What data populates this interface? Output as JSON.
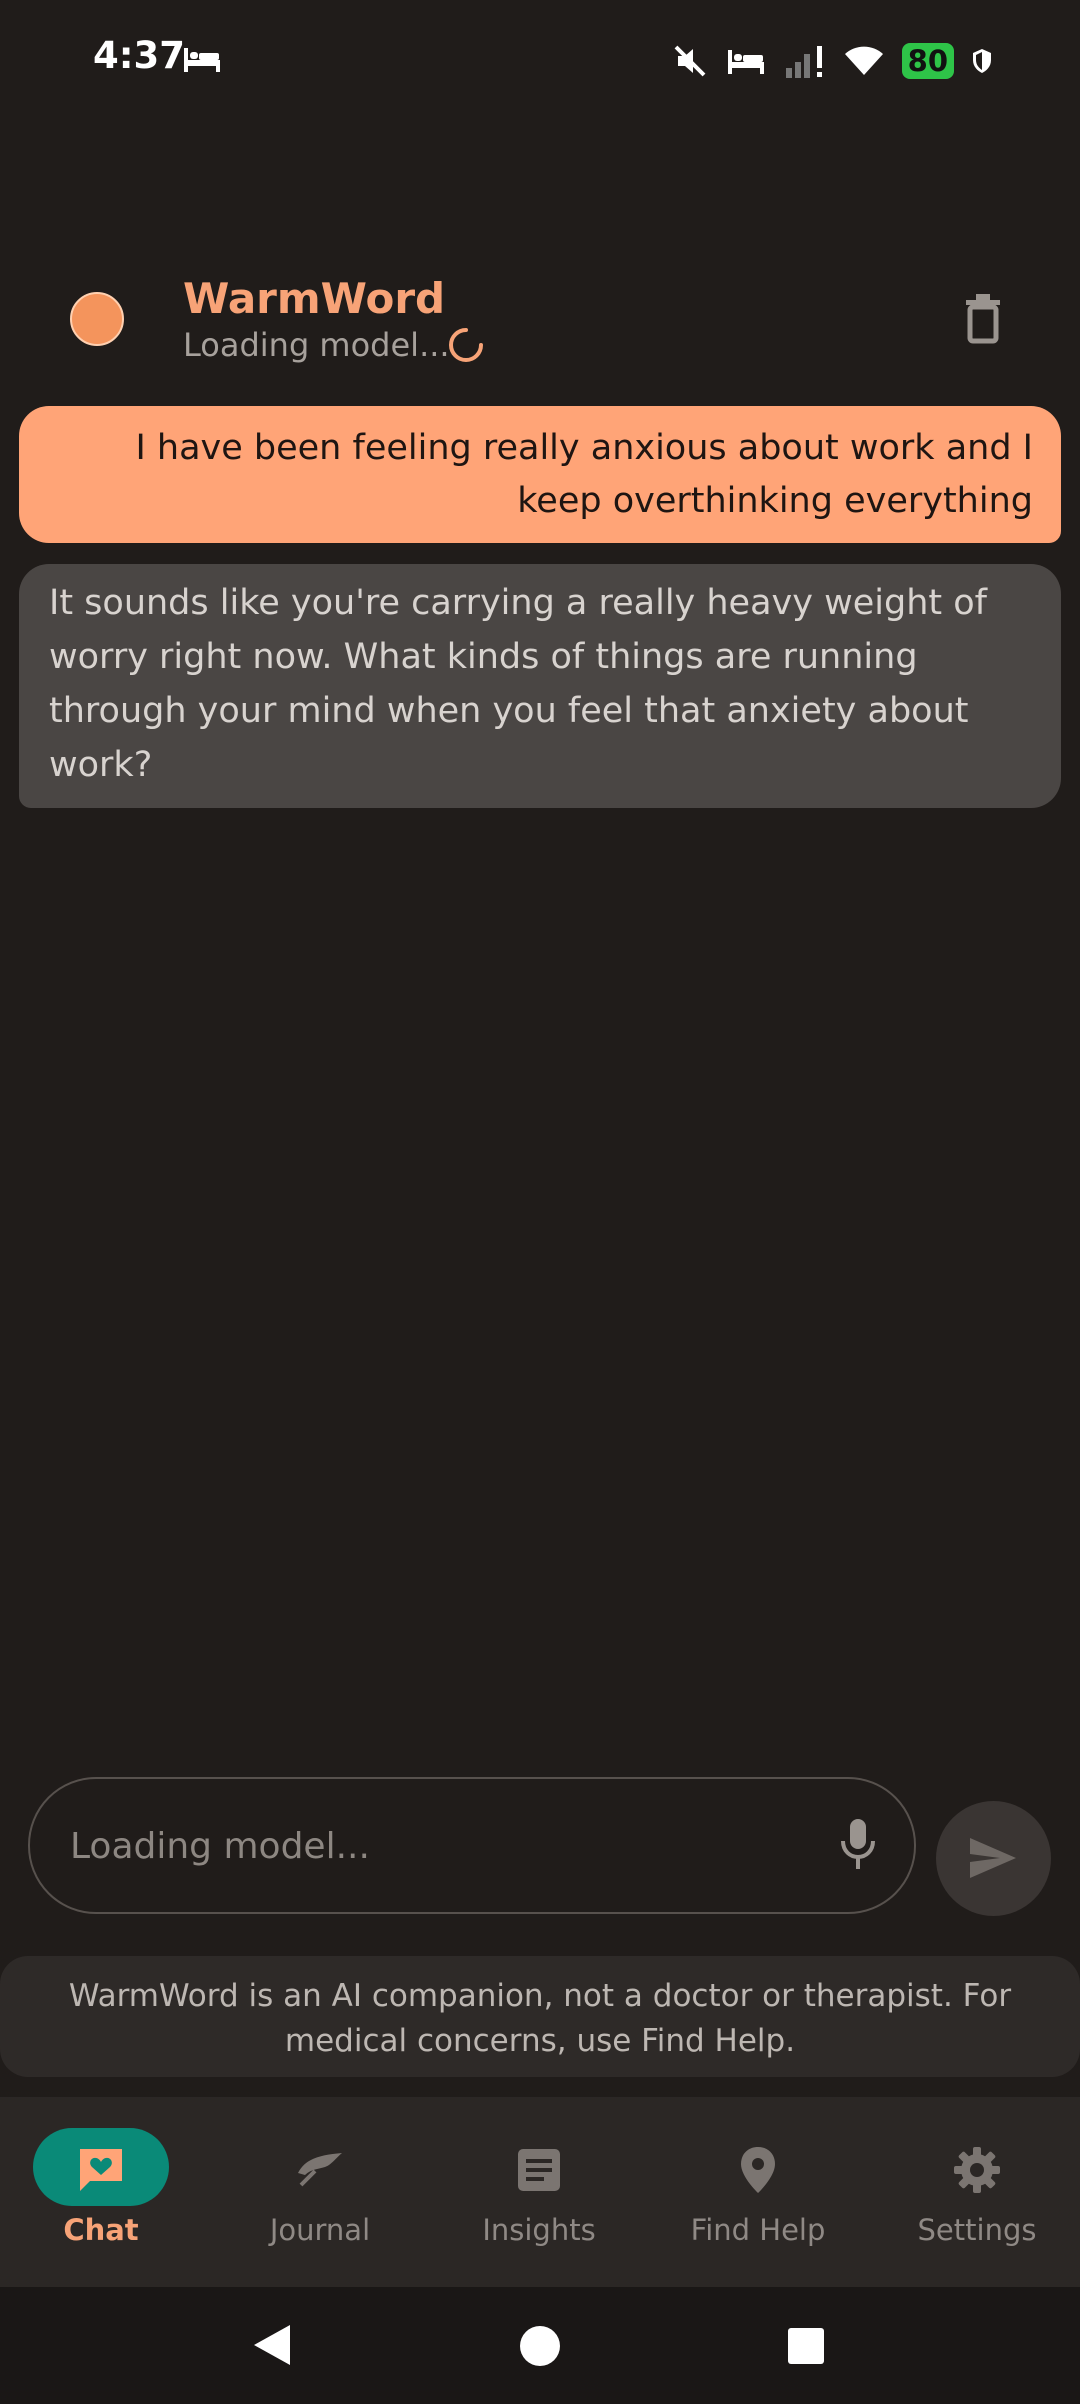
{
  "status": {
    "time": "4:37",
    "battery": "80"
  },
  "header": {
    "title": "WarmWord",
    "subtitle": "Loading model..."
  },
  "messages": [
    {
      "role": "user",
      "text": "I have been feeling really anxious about work and I keep overthinking everything"
    },
    {
      "role": "assistant",
      "text": "It sounds like you're carrying a really heavy weight of worry right now. What kinds of things are running through your mind when you feel that anxiety about work?"
    }
  ],
  "composer": {
    "placeholder": "Loading model..."
  },
  "disclaimer": "WarmWord is an AI companion, not a doctor or therapist. For medical concerns, use Find Help.",
  "nav": {
    "items": [
      {
        "label": "Chat",
        "icon": "chat-icon",
        "active": true
      },
      {
        "label": "Journal",
        "icon": "journal-icon"
      },
      {
        "label": "Insights",
        "icon": "insights-icon"
      },
      {
        "label": "Find Help",
        "icon": "location-icon"
      },
      {
        "label": "Settings",
        "icon": "settings-icon"
      }
    ]
  },
  "colors": {
    "background": "#201c1a",
    "accent": "#f7a377",
    "user_bubble": "#ffa477",
    "assistant_bubble": "#4a4644",
    "nav_active": "#0a8a78"
  }
}
